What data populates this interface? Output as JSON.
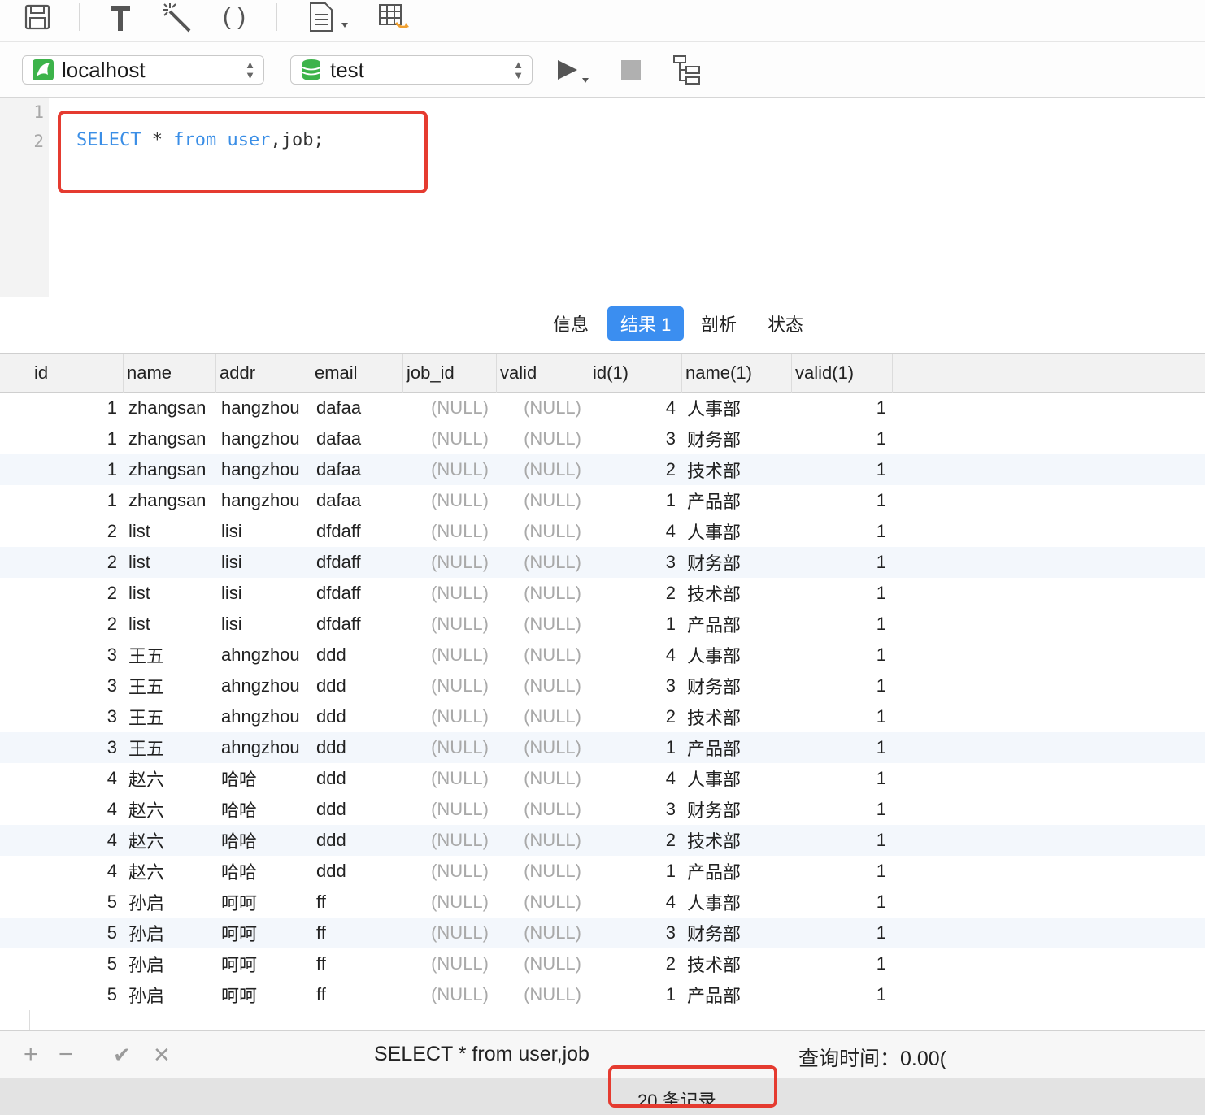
{
  "toolbar": {
    "icons": [
      "save-icon",
      "format-icon",
      "magic-wand-icon",
      "parentheses-icon",
      "document-icon",
      "table-export-icon"
    ]
  },
  "connection": {
    "host": "localhost",
    "database": "test"
  },
  "editor": {
    "line_numbers": [
      "1",
      "2"
    ],
    "code": {
      "kw_select": "SELECT",
      "star": " * ",
      "kw_from": "from",
      "space": " ",
      "kw_user": "user",
      "rest": ",job;"
    }
  },
  "tabs": [
    {
      "label": "信息",
      "active": false
    },
    {
      "label": "结果 1",
      "active": true
    },
    {
      "label": "剖析",
      "active": false
    },
    {
      "label": "状态",
      "active": false
    }
  ],
  "grid": {
    "columns": [
      "id",
      "name",
      "addr",
      "email",
      "job_id",
      "valid",
      "id(1)",
      "name(1)",
      "valid(1)"
    ],
    "rows": [
      [
        "1",
        "zhangsan",
        "hangzhou",
        "dafaa",
        "(NULL)",
        "(NULL)",
        "4",
        "人事部",
        "1"
      ],
      [
        "1",
        "zhangsan",
        "hangzhou",
        "dafaa",
        "(NULL)",
        "(NULL)",
        "3",
        "财务部",
        "1"
      ],
      [
        "1",
        "zhangsan",
        "hangzhou",
        "dafaa",
        "(NULL)",
        "(NULL)",
        "2",
        "技术部",
        "1"
      ],
      [
        "1",
        "zhangsan",
        "hangzhou",
        "dafaa",
        "(NULL)",
        "(NULL)",
        "1",
        "产品部",
        "1"
      ],
      [
        "2",
        "list",
        "lisi",
        "dfdaff",
        "(NULL)",
        "(NULL)",
        "4",
        "人事部",
        "1"
      ],
      [
        "2",
        "list",
        "lisi",
        "dfdaff",
        "(NULL)",
        "(NULL)",
        "3",
        "财务部",
        "1"
      ],
      [
        "2",
        "list",
        "lisi",
        "dfdaff",
        "(NULL)",
        "(NULL)",
        "2",
        "技术部",
        "1"
      ],
      [
        "2",
        "list",
        "lisi",
        "dfdaff",
        "(NULL)",
        "(NULL)",
        "1",
        "产品部",
        "1"
      ],
      [
        "3",
        "王五",
        "ahngzhou",
        "ddd",
        "(NULL)",
        "(NULL)",
        "4",
        "人事部",
        "1"
      ],
      [
        "3",
        "王五",
        "ahngzhou",
        "ddd",
        "(NULL)",
        "(NULL)",
        "3",
        "财务部",
        "1"
      ],
      [
        "3",
        "王五",
        "ahngzhou",
        "ddd",
        "(NULL)",
        "(NULL)",
        "2",
        "技术部",
        "1"
      ],
      [
        "3",
        "王五",
        "ahngzhou",
        "ddd",
        "(NULL)",
        "(NULL)",
        "1",
        "产品部",
        "1"
      ],
      [
        "4",
        "赵六",
        "哈哈",
        "ddd",
        "(NULL)",
        "(NULL)",
        "4",
        "人事部",
        "1"
      ],
      [
        "4",
        "赵六",
        "哈哈",
        "ddd",
        "(NULL)",
        "(NULL)",
        "3",
        "财务部",
        "1"
      ],
      [
        "4",
        "赵六",
        "哈哈",
        "ddd",
        "(NULL)",
        "(NULL)",
        "2",
        "技术部",
        "1"
      ],
      [
        "4",
        "赵六",
        "哈哈",
        "ddd",
        "(NULL)",
        "(NULL)",
        "1",
        "产品部",
        "1"
      ],
      [
        "5",
        "孙启",
        "呵呵",
        "ff",
        "(NULL)",
        "(NULL)",
        "4",
        "人事部",
        "1"
      ],
      [
        "5",
        "孙启",
        "呵呵",
        "ff",
        "(NULL)",
        "(NULL)",
        "3",
        "财务部",
        "1"
      ],
      [
        "5",
        "孙启",
        "呵呵",
        "ff",
        "(NULL)",
        "(NULL)",
        "2",
        "技术部",
        "1"
      ],
      [
        "5",
        "孙启",
        "呵呵",
        "ff",
        "(NULL)",
        "(NULL)",
        "1",
        "产品部",
        "1"
      ]
    ]
  },
  "status": {
    "add": "+",
    "remove": "−",
    "apply": "✔",
    "discard": "✕",
    "query": "SELECT * from user,job",
    "time_label": "查询时间：0.00(",
    "record_count": "20 条记录"
  },
  "colors": {
    "highlight": "#e53b30",
    "keyword": "#3a8ee6",
    "active_tab": "#3b8ef0"
  }
}
